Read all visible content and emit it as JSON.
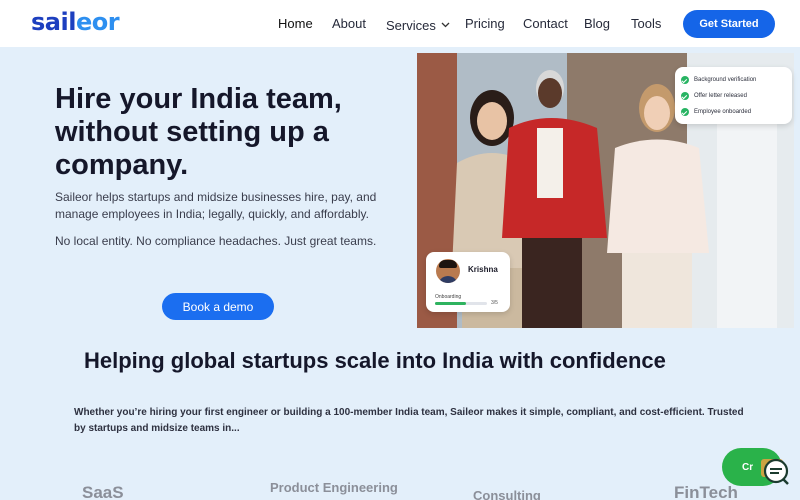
{
  "header": {
    "logo": {
      "main": "sail",
      "accent": "eor"
    },
    "nav": [
      {
        "label": "Home",
        "active": true
      },
      {
        "label": "About"
      },
      {
        "label": "Services",
        "dropdown": true
      },
      {
        "label": "Pricing"
      },
      {
        "label": "Contact"
      },
      {
        "label": "Blog"
      },
      {
        "label": "Tools"
      }
    ],
    "cta_label": "Get Started"
  },
  "hero": {
    "title": "Hire your India team, without setting up a company.",
    "description": "Saileor helps startups and midsize businesses hire, pay, and manage employees in India; legally, quickly, and affordably.",
    "note": "No local entity. No compliance headaches. Just great teams.",
    "demo_label": "Book a demo"
  },
  "checklist": [
    "Background verification",
    "Offer letter released",
    "Employee onboarded"
  ],
  "profile_card": {
    "name": "Krishna",
    "status": "Onboarding",
    "progress_text": "3/5",
    "progress_fraction": 0.6
  },
  "section": {
    "title": "Helping global startups scale into India with confidence",
    "description": "Whether you’re hiring your first engineer or building a 100-member India team, Saileor makes it simple, compliant, and cost-efficient. Trusted by startups and midsize teams in..."
  },
  "categories": [
    "SaaS",
    "Product Engineering",
    "Consulting",
    "FinTech"
  ],
  "chat": {
    "label": "Chat",
    "visible_text": "Cr"
  },
  "colors": {
    "primary": "#1565e8",
    "brand_dark": "#1d3fbf",
    "brand_light": "#2d8ff0",
    "page_bg": "#e3effa",
    "success": "#28b463"
  }
}
